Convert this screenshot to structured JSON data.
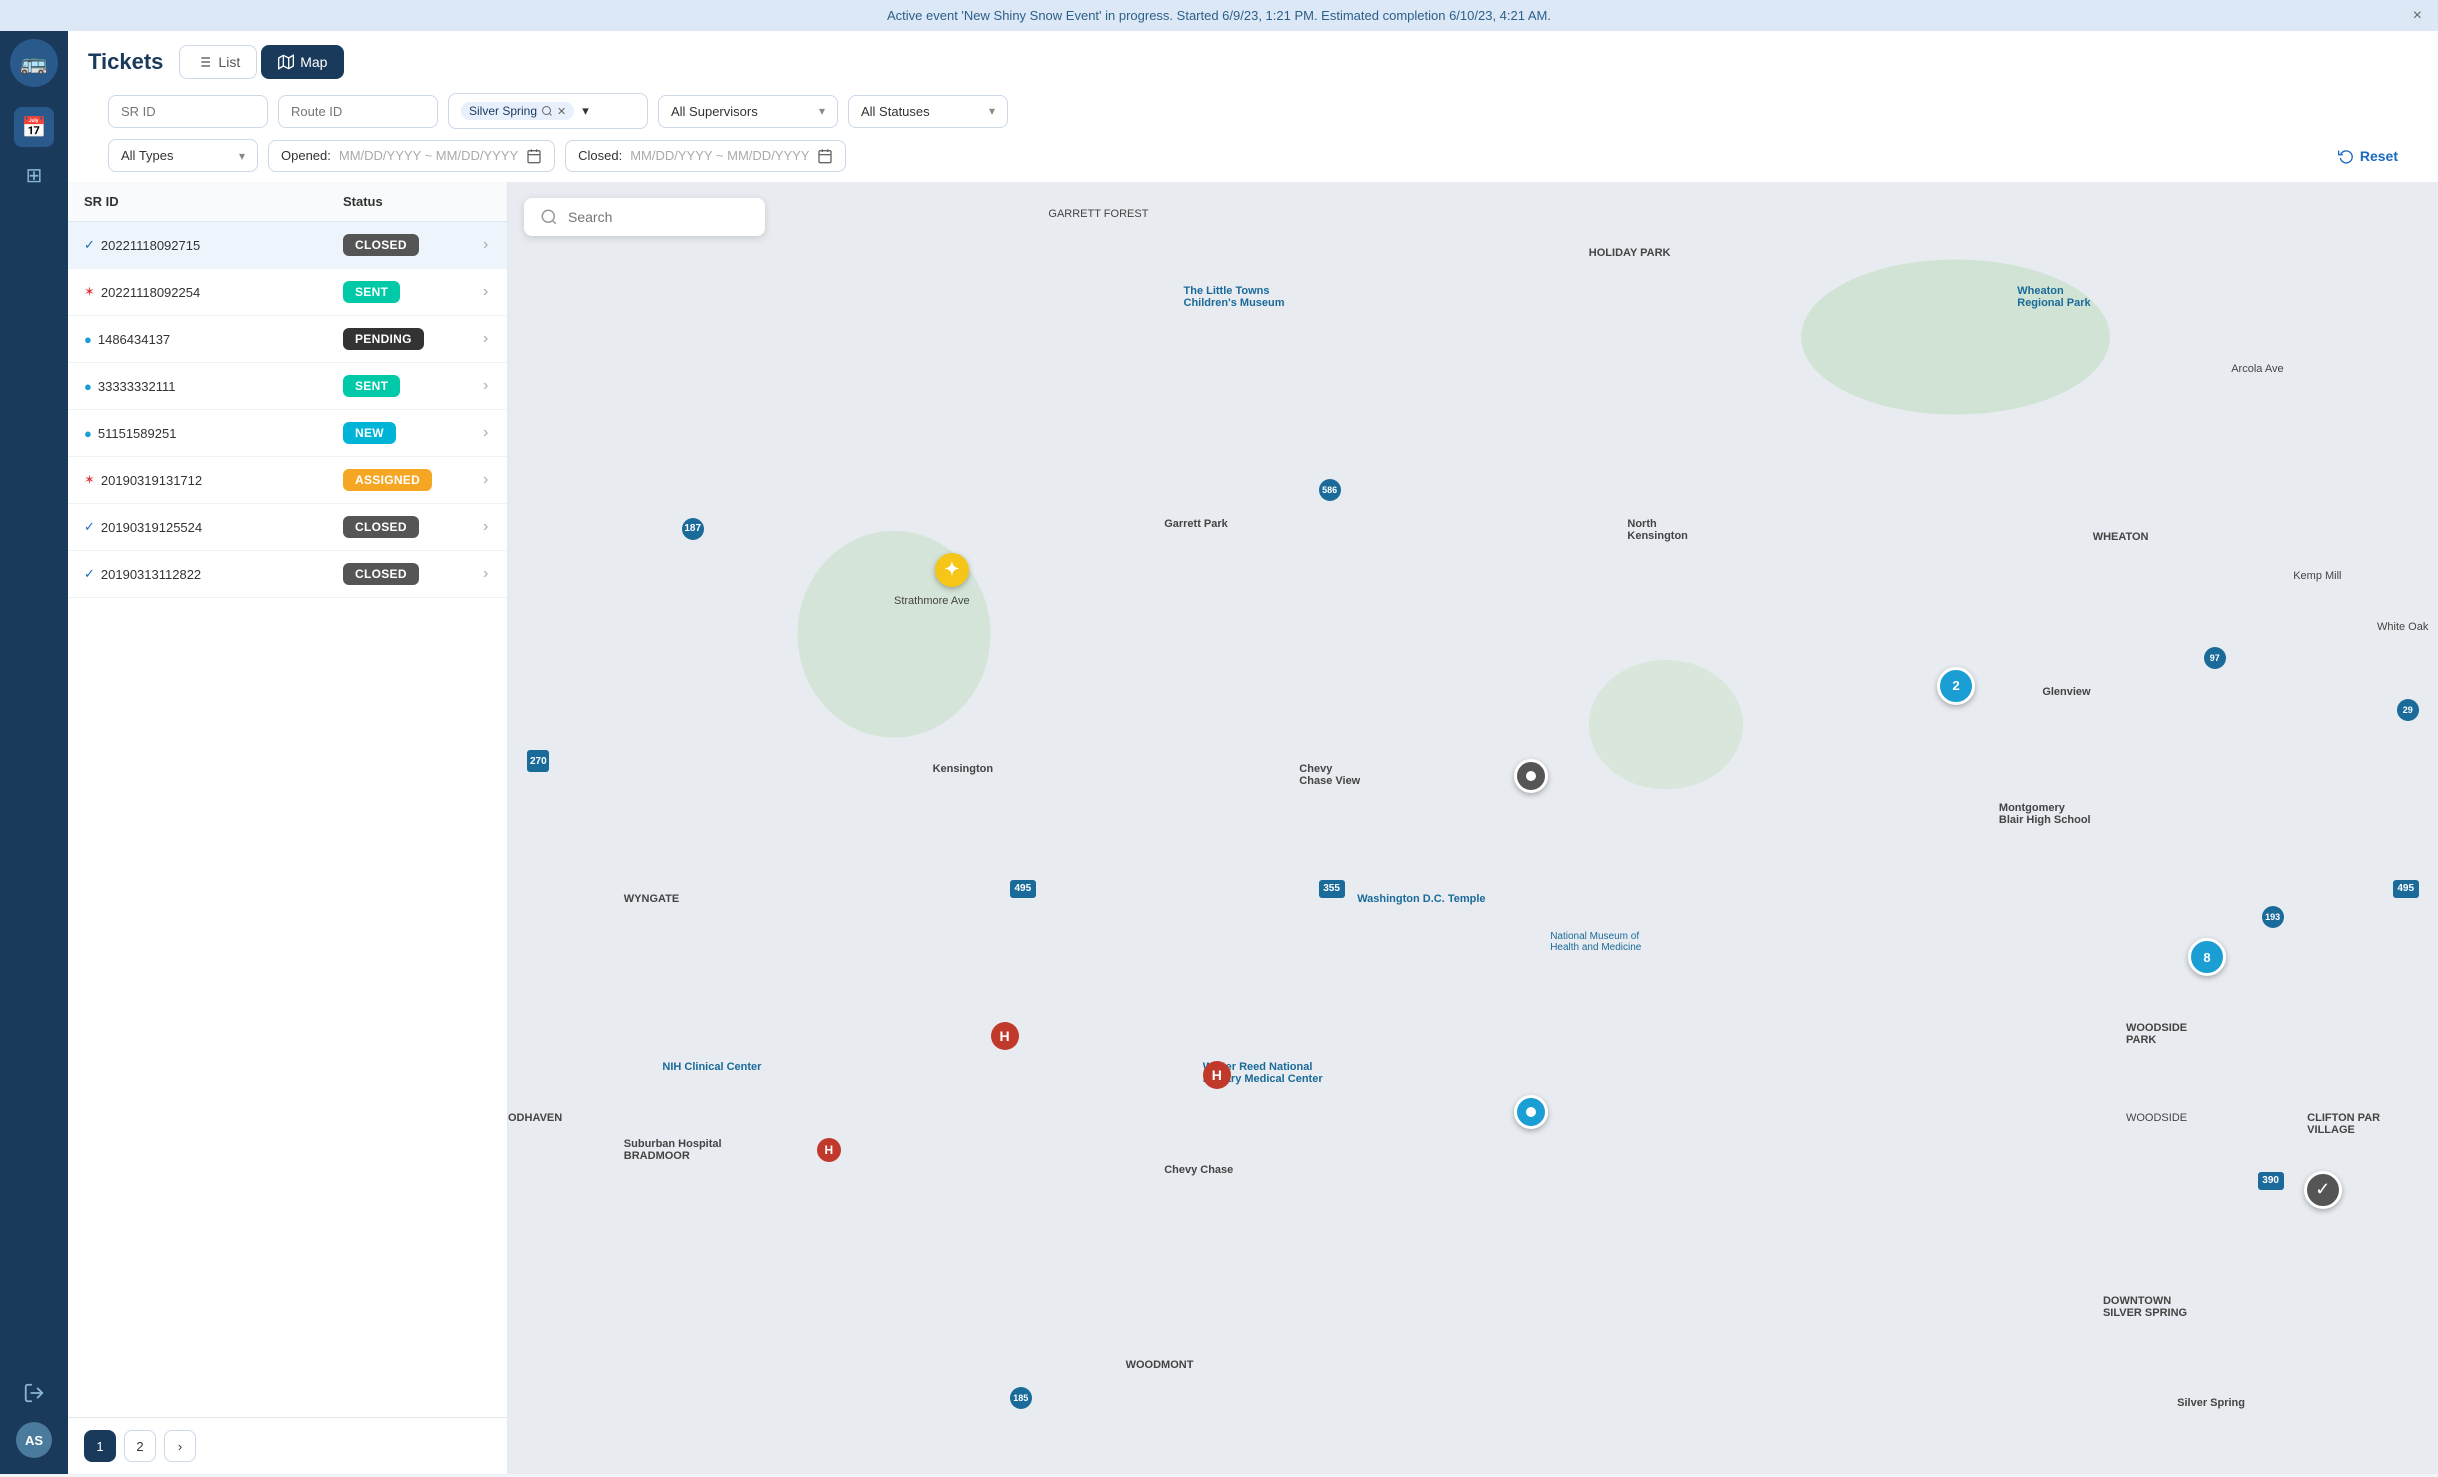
{
  "banner": {
    "text": "Active event 'New Shiny Snow Event' in progress. Started 6/9/23, 1:21 PM. Estimated completion 6/10/23, 4:21 AM.",
    "close_label": "×"
  },
  "header": {
    "title": "Tickets",
    "view_list_label": "List",
    "view_map_label": "Map"
  },
  "filters": {
    "sr_id_placeholder": "SR ID",
    "route_id_placeholder": "Route ID",
    "location_tag": "Silver Spring",
    "all_supervisors_label": "All Supervisors",
    "all_statuses_label": "All Statuses",
    "all_types_label": "All Types",
    "opened_label": "Opened:",
    "opened_placeholder": "MM/DD/YYYY ~ MM/DD/YYYY",
    "closed_label": "Closed:",
    "closed_placeholder": "MM/DD/YYYY ~ MM/DD/YYYY",
    "reset_label": "Reset"
  },
  "table": {
    "col_sr_id": "SR ID",
    "col_status": "Status",
    "rows": [
      {
        "id": "20221118092715",
        "indicator": "check",
        "status": "CLOSED",
        "badge_class": "badge-closed"
      },
      {
        "id": "20221118092254",
        "indicator": "star",
        "status": "SENT",
        "badge_class": "badge-sent"
      },
      {
        "id": "1486434137",
        "indicator": "circle-blue",
        "status": "PENDING",
        "badge_class": "badge-pending"
      },
      {
        "id": "33333332111",
        "indicator": "circle-blue",
        "status": "SENT",
        "badge_class": "badge-sent"
      },
      {
        "id": "51151589251",
        "indicator": "circle-blue",
        "status": "NEW",
        "badge_class": "badge-new"
      },
      {
        "id": "20190319131712",
        "indicator": "star",
        "status": "ASSIGNED",
        "badge_class": "badge-assigned"
      },
      {
        "id": "20190319125524",
        "indicator": "check",
        "status": "CLOSED",
        "badge_class": "badge-closed"
      },
      {
        "id": "20190313112822",
        "indicator": "check",
        "status": "CLOSED",
        "badge_class": "badge-closed"
      }
    ]
  },
  "pagination": {
    "pages": [
      "1",
      "2"
    ],
    "active": "1",
    "next_label": "›"
  },
  "map": {
    "search_placeholder": "Search",
    "search_icon": "🔍"
  },
  "sidebar": {
    "logo_icon": "🚌",
    "logout_icon": "→",
    "avatar_text": "AS",
    "nav_items": [
      {
        "icon": "📅",
        "name": "calendar",
        "active": true
      },
      {
        "icon": "⊞",
        "name": "grid",
        "active": false
      }
    ]
  }
}
